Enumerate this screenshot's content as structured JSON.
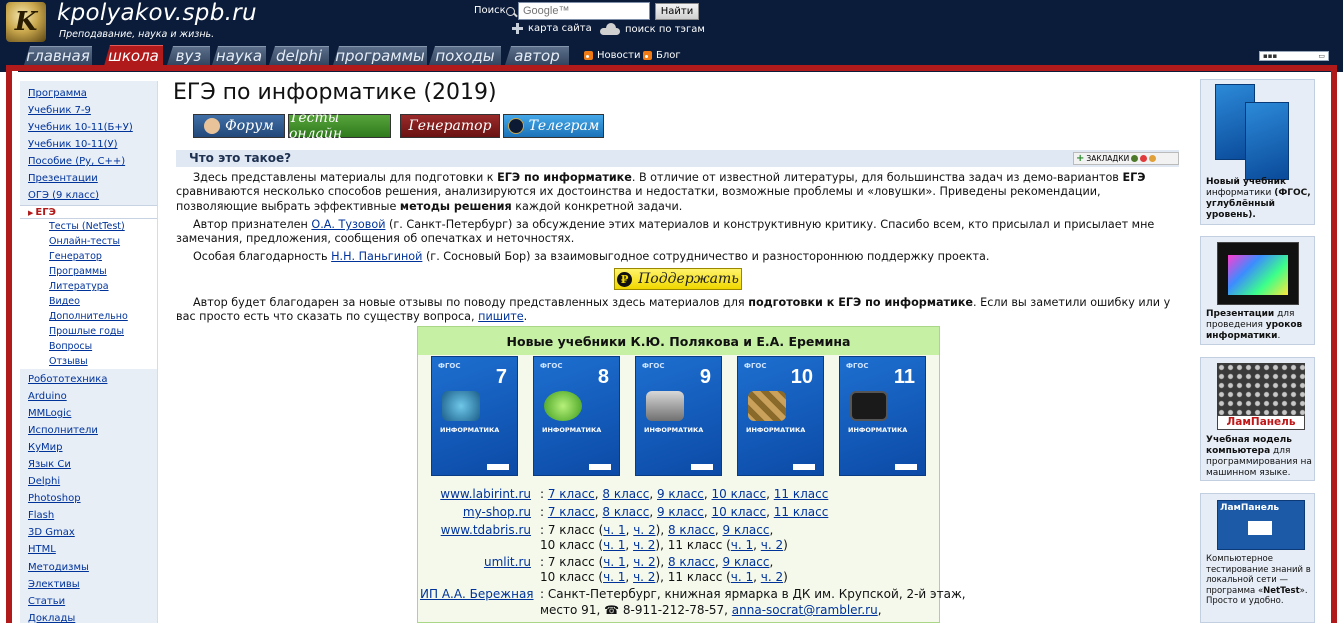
{
  "header": {
    "site_title": "kpolyakov.spb.ru",
    "tagline": "Преподавание, наука и жизнь.",
    "search_label": "Поиск",
    "search_placeholder": "Google™",
    "search_button": "Найти",
    "sitemap_label": "карта сайта",
    "tag_search_label": "поиск по тэгам"
  },
  "nav": {
    "tabs": [
      "главная",
      "школа",
      "вуз",
      "наука",
      "delphi",
      "программы",
      "походы",
      "автор"
    ],
    "active_tab": "школа",
    "news_label": "Новости",
    "blog_label": "Блог"
  },
  "sidebar": {
    "items": [
      "Программа",
      "Учебник 7-9",
      "Учебник 10-11(Б+У)",
      "Учебник 10-11(У)",
      "Пособие (Py, C++)",
      "Презентации",
      "ОГЭ (9 класс)"
    ],
    "active_item": "ЕГЭ",
    "sub_items": [
      "Тесты (NetTest)",
      "Онлайн-тесты",
      "Генератор",
      "Программы",
      "Литература",
      "Видео",
      "Дополнительно",
      "Прошлые годы",
      "Вопросы",
      "Отзывы"
    ],
    "items_after": [
      "Робототехника",
      "Arduino",
      "MMLogic",
      "Исполнители",
      "КуМир",
      "Язык Си",
      "Delphi",
      "Photoshop",
      "Flash",
      "3D Gmax",
      "HTML",
      "Методизмы",
      "Элективы",
      "Статьи",
      "Доклады"
    ]
  },
  "main": {
    "title": "ЕГЭ по информатике (2019)",
    "buttons": {
      "forum": "Форум",
      "tests": "Тесты онлайн",
      "generator": "Генератор",
      "telegram": "Телеграм"
    },
    "section_title": "Что это такое?",
    "bookmarks_label": "ЗАКЛАДКИ",
    "p1": {
      "t1": "Здесь представлены материалы для подготовки к ",
      "b1": "ЕГЭ по информатике",
      "t2": ". В отличие от известной литературы, для большинства задач из демо-вариантов ",
      "b2": "ЕГЭ",
      "t3": " сравниваются несколько способов решения, анализируются их достоинства и недостатки, возможные проблемы и «ловушки». Приведены рекомендации, позволяющие выбрать эффективные ",
      "b3": "методы решения",
      "t4": " каждой конкретной задачи."
    },
    "p2": {
      "t1": "Автор признателен ",
      "link": "О.А. Тузовой",
      "t2": " (г. Санкт-Петербург) за обсуждение этих материалов и конструктивную критику. Спасибо всем, кто присылал и присылает мне замечания, предложения, сообщения об опечатках и неточностях."
    },
    "p3": {
      "t1": "Особая благодарность ",
      "link": "Н.Н. Паньгиной",
      "t2": " (г. Сосновый Бор) за взаимовыгодное сотрудничество и разностороннюю поддержку проекта."
    },
    "support_button": "Поддержать",
    "support_symbol": "₽",
    "p4": {
      "t1": "Автор будет благодарен за новые отзывы по поводу представленных здесь материалов для ",
      "b1": "подготовки к ЕГЭ по информатике",
      "t2": ". Если вы заметили ошибку или у вас просто есть что сказать по существу вопроса, ",
      "link": "пишите",
      "t3": "."
    }
  },
  "books": {
    "heading": "Новые учебники К.Ю. Полякова и Е.А. Еремина",
    "covers": [
      {
        "grade": "7",
        "subject": "ИНФОРМАТИКА",
        "fgos": "ФГОС"
      },
      {
        "grade": "8",
        "subject": "ИНФОРМАТИКА",
        "fgos": "ФГОС"
      },
      {
        "grade": "9",
        "subject": "ИНФОРМАТИКА",
        "fgos": "ФГОС"
      },
      {
        "grade": "10",
        "subject": "ИНФОРМАТИКА",
        "fgos": "ФГОС"
      },
      {
        "grade": "11",
        "subject": "ИНФОРМАТИКА",
        "fgos": "ФГОС"
      }
    ],
    "shops": [
      {
        "name": "www.labirint.ru",
        "line1": [
          "7 класс",
          "8 класс",
          "9 класс",
          "10 класс",
          "11 класс"
        ]
      },
      {
        "name": "my-shop.ru",
        "line1": [
          "7 класс",
          "8 класс",
          "9 класс",
          "10 класс",
          "11 класс"
        ]
      },
      {
        "name": "www.tdabris.ru",
        "grade7": "7 класс",
        "g10": "10 класс",
        "g11": "11 класс",
        "ch1": "ч. 1",
        "ch2": "ч. 2",
        "g8": "8 класс",
        "g9": "9 класс"
      },
      {
        "name": "umlit.ru",
        "grade7": "7 класс",
        "g10": "10 класс",
        "g11": "11 класс",
        "ch1": "ч. 1",
        "ch2": "ч. 2",
        "g8": "8 класс",
        "g9": "9 класс"
      },
      {
        "name": "ИП А.А. Бережная",
        "text1": "Санкт-Петербург, книжная ярмарка в ДК им. Крупской, 2-й этаж,",
        "text2": "место 91, ",
        "phone": "8-911-212-78-57, ",
        "email": "anna-socrat@rambler.ru",
        "text3": ","
      }
    ],
    "phone_symbol": "☎"
  },
  "right_sidebar": {
    "card1": {
      "t1": "Новый учебник",
      "t2": "информатики ",
      "t3": "(ФГОС,",
      "t4": "углублённый",
      "t5": "уровень)."
    },
    "card2": {
      "t1": "Презентации",
      "t1b": " для",
      "t2": "проведения ",
      "t2b": "уроков",
      "t3": "информатики",
      "t3b": "."
    },
    "card3": {
      "logo": "ЛамПанель",
      "t1": "Учебная модель",
      "t2": "компьютера",
      "t2b": " для",
      "t3": "программирования на",
      "t4": "машинном языке."
    },
    "card4": {
      "logo": "ЛамПанель",
      "t1": "Компьютерное",
      "t2": "тестирование знаний в",
      "t3": "локальной сети —",
      "t4": "программа «",
      "t4b": "NetTest",
      "t4c": "».",
      "t5": "Просто и удобно."
    }
  },
  "colors": {
    "header_bg": "#0b1c3a",
    "accent_red": "#b11a1a",
    "link": "#00339a",
    "books_green": "#c6f0a4"
  }
}
